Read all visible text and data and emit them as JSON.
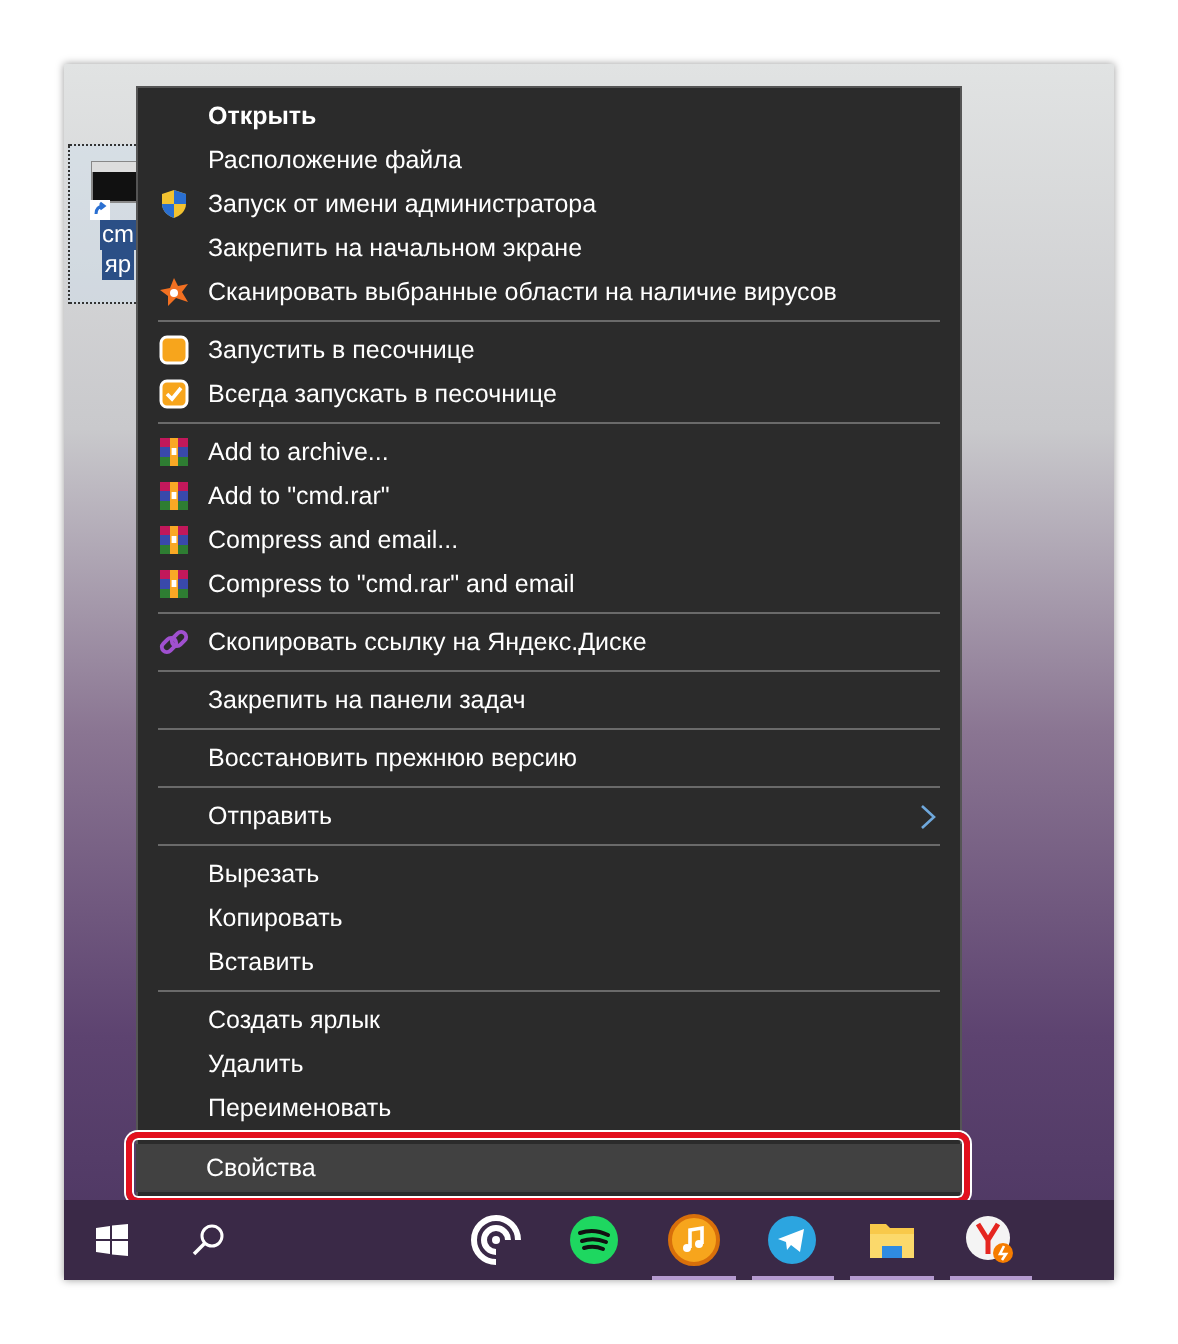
{
  "desktop_icon": {
    "label_lines": [
      "cm",
      "яр"
    ],
    "selected": true
  },
  "context_menu": {
    "groups": [
      {
        "items": [
          {
            "label": "Открыть",
            "kind": "plain",
            "bold": true,
            "selected": false
          },
          {
            "label": "Расположение файла",
            "kind": "plain",
            "bold": false,
            "selected": false
          },
          {
            "label": "Запуск от имени администратора",
            "kind": "shield",
            "bold": false,
            "selected": false
          },
          {
            "label": "Закрепить на начальном экране",
            "kind": "plain",
            "bold": false,
            "selected": false
          },
          {
            "label": "Сканировать выбранные области на наличие вирусов",
            "kind": "antivirus",
            "bold": false,
            "selected": false
          }
        ]
      },
      {
        "items": [
          {
            "label": "Запустить в песочнице",
            "kind": "sandbox",
            "bold": false,
            "selected": false
          },
          {
            "label": "Всегда запускать в песочнице",
            "kind": "sandbox-check",
            "bold": false,
            "selected": false
          }
        ]
      },
      {
        "items": [
          {
            "label": "Add to archive...",
            "kind": "archive",
            "bold": false,
            "selected": false
          },
          {
            "label": "Add to \"cmd.rar\"",
            "kind": "archive",
            "bold": false,
            "selected": false
          },
          {
            "label": "Compress and email...",
            "kind": "archive",
            "bold": false,
            "selected": false
          },
          {
            "label": "Compress to \"cmd.rar\" and email",
            "kind": "archive",
            "bold": false,
            "selected": false
          }
        ]
      },
      {
        "items": [
          {
            "label": "Скопировать ссылку на Яндекс.Диске",
            "kind": "link",
            "bold": false,
            "selected": false
          }
        ]
      },
      {
        "items": [
          {
            "label": "Закрепить на панели задач",
            "kind": "plain",
            "bold": false,
            "selected": false
          }
        ]
      },
      {
        "items": [
          {
            "label": "Восстановить прежнюю версию",
            "kind": "plain",
            "bold": false,
            "selected": false
          }
        ]
      },
      {
        "items": [
          {
            "label": "Отправить",
            "kind": "submenu",
            "bold": false,
            "selected": false
          }
        ]
      },
      {
        "items": [
          {
            "label": "Вырезать",
            "kind": "plain",
            "bold": false,
            "selected": false
          },
          {
            "label": "Копировать",
            "kind": "plain",
            "bold": false,
            "selected": false
          },
          {
            "label": "Вставить",
            "kind": "plain",
            "bold": false,
            "selected": false
          }
        ]
      },
      {
        "items": [
          {
            "label": "Создать ярлык",
            "kind": "plain",
            "bold": false,
            "selected": false
          },
          {
            "label": "Удалить",
            "kind": "plain",
            "bold": false,
            "selected": false
          },
          {
            "label": "Переименовать",
            "kind": "plain",
            "bold": false,
            "selected": false
          }
        ]
      },
      {
        "items": [
          {
            "label": "Свойства",
            "kind": "plain",
            "bold": false,
            "selected": true
          }
        ]
      }
    ]
  },
  "taskbar": {
    "apps": [
      {
        "kind": "podcast",
        "running": false
      },
      {
        "kind": "spotify",
        "running": false
      },
      {
        "kind": "music",
        "running": true
      },
      {
        "kind": "telegram",
        "running": true
      },
      {
        "kind": "folder",
        "running": true
      },
      {
        "kind": "yandex",
        "running": true
      }
    ]
  }
}
